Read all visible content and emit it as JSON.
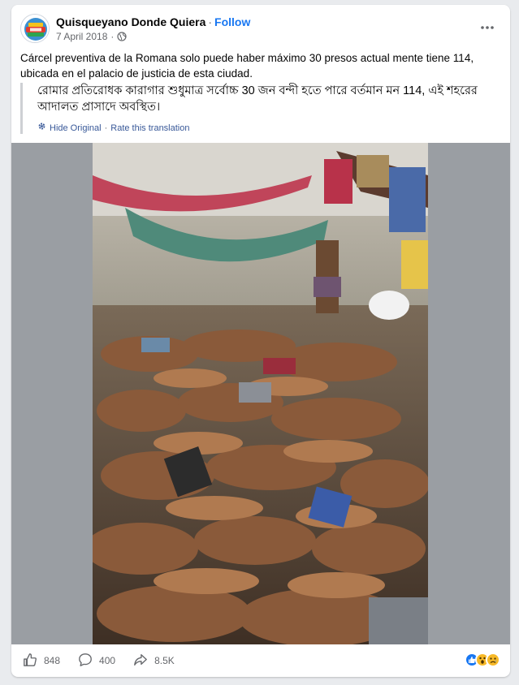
{
  "post": {
    "author": "Quisqueyano Donde Quiera",
    "separator": "·",
    "follow_label": "Follow",
    "date": "7 April 2018",
    "date_separator": "·",
    "more_icon": "more-horizontal-icon",
    "text": "Cárcel preventiva de la Romana solo puede haber máximo 30 presos actual mente tiene 114, ubicada en el palacio de justicia de esta ciudad.",
    "audience_icon": "globe-icon"
  },
  "translation": {
    "text": "রোমার প্রতিরোধক কারাগার শুধুমাত্র সর্বোচ্চ 30 জন বন্দী হতে পারে বর্তমান মন 114, এই শহরের আদালত প্রাসাদে অবস্থিত।",
    "hide_label": "Hide Original",
    "separator": "·",
    "rate_label": "Rate this translation",
    "icon": "translate-gear-icon"
  },
  "footer": {
    "like_count": "848",
    "comment_count": "400",
    "share_count": "8.5K",
    "reactions": [
      "like",
      "wow",
      "sad"
    ]
  },
  "colors": {
    "accent": "#1877f2",
    "link": "#385898",
    "muted": "#65676b",
    "background": "#e9ebee"
  }
}
